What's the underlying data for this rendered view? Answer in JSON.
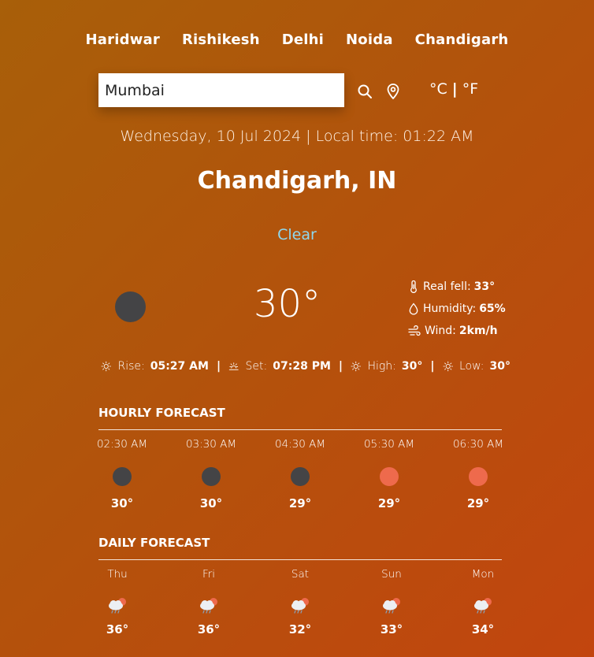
{
  "cities": [
    "Haridwar",
    "Rishikesh",
    "Delhi",
    "Noida",
    "Chandigarh"
  ],
  "search": {
    "value": "Mumbai"
  },
  "units": {
    "celsius": "°C",
    "separator": "|",
    "fahrenheit": "°F"
  },
  "datetime": "Wednesday, 10 Jul 2024 | Local time: 01:22 AM",
  "location": "Chandigarh, IN",
  "condition": "Clear",
  "colors": {
    "condition": "#8ed8ef",
    "night_dot": "#444446",
    "day_dot": "#ee6a4c"
  },
  "current": {
    "temp": "30°",
    "icon": "dark-moon-dot",
    "real_feel_label": "Real fell:",
    "real_feel": "33°",
    "humidity_label": "Humidity:",
    "humidity": "65%",
    "wind_label": "Wind:",
    "wind": "2km/h"
  },
  "sun": {
    "rise_label": "Rise:",
    "rise": "05:27 AM",
    "set_label": "Set:",
    "set": "07:28 PM",
    "high_label": "High:",
    "high": "30°",
    "low_label": "Low:",
    "low": "30°",
    "separator": "|"
  },
  "hourly": {
    "title": "HOURLY FORECAST",
    "items": [
      {
        "time": "02:30 AM",
        "icon": "night-dot",
        "temp": "30°"
      },
      {
        "time": "03:30 AM",
        "icon": "night-dot",
        "temp": "30°"
      },
      {
        "time": "04:30 AM",
        "icon": "night-dot",
        "temp": "29°"
      },
      {
        "time": "05:30 AM",
        "icon": "day-dot",
        "temp": "29°"
      },
      {
        "time": "06:30 AM",
        "icon": "day-dot",
        "temp": "29°"
      }
    ]
  },
  "daily": {
    "title": "DAILY FORECAST",
    "items": [
      {
        "day": "Thu",
        "icon": "rain-cloud-sun-icon",
        "temp": "36°"
      },
      {
        "day": "Fri",
        "icon": "rain-cloud-sun-icon",
        "temp": "36°"
      },
      {
        "day": "Sat",
        "icon": "rain-cloud-sun-icon",
        "temp": "32°"
      },
      {
        "day": "Sun",
        "icon": "rain-cloud-sun-icon",
        "temp": "33°"
      },
      {
        "day": "Mon",
        "icon": "rain-cloud-sun-icon",
        "temp": "34°"
      }
    ]
  }
}
